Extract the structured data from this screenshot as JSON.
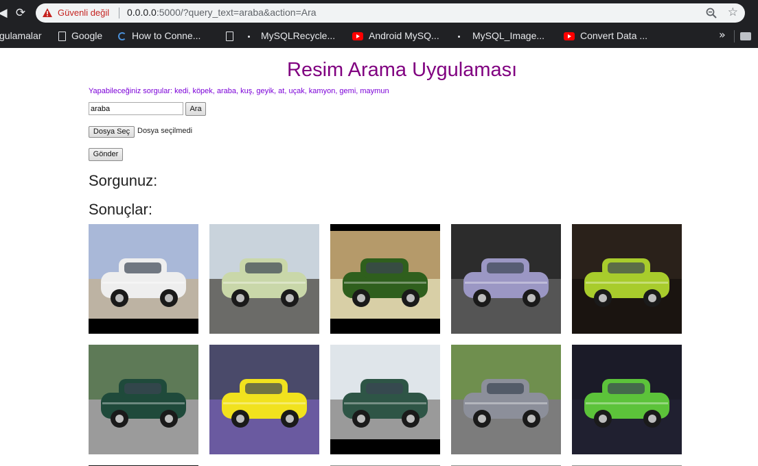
{
  "browser": {
    "security_label": "Güvenli değil",
    "url_host": "0.0.0.0",
    "url_rest": ":5000/?query_text=araba&action=Ara",
    "bookmarks": [
      {
        "label": "gulamalar",
        "icon": "none"
      },
      {
        "label": "Google",
        "icon": "doc-icon"
      },
      {
        "label": "How to Conne...",
        "icon": "loading-icon"
      },
      {
        "label": "",
        "icon": "doc-icon"
      },
      {
        "label": "MySQLRecycle...",
        "icon": "dot-icon"
      },
      {
        "label": "Android MySQ...",
        "icon": "youtube-icon"
      },
      {
        "label": "MySQL_Image...",
        "icon": "dot-icon"
      },
      {
        "label": "Convert Data ...",
        "icon": "youtube-icon"
      }
    ],
    "more_label": "»"
  },
  "page": {
    "title": "Resim Arama Uygulaması",
    "hint": "Yapabileceğiniz sorgular: kedi, köpek, araba, kuş, geyik, at, uçak, kamyon, gemi, maymun",
    "search_value": "araba",
    "search_button": "Ara",
    "file_button": "Dosya Seç",
    "file_status": "Dosya seçilmedi",
    "submit_button": "Gönder",
    "query_heading": "Sorgunuz:",
    "results_heading": "Sonuçlar:"
  },
  "results": [
    {
      "name": "white convertible by the sea",
      "colors": {
        "sky": "#a9b8d8",
        "ground": "#bdb3a3",
        "body": "#eeeeee",
        "frame": "#000000"
      }
    },
    {
      "name": "pale green vintage car",
      "colors": {
        "sky": "#c9d3dc",
        "ground": "#6b6b68",
        "body": "#c9d7a9",
        "frame": "#000000"
      }
    },
    {
      "name": "dark green muscle car",
      "colors": {
        "sky": "#b59a6a",
        "ground": "#d8cfa6",
        "body": "#2f5f1d",
        "frame": "#000000"
      }
    },
    {
      "name": "small purple electric car",
      "colors": {
        "sky": "#2c2c2c",
        "ground": "#555555",
        "body": "#9b97c4",
        "frame": "#000000"
      }
    },
    {
      "name": "lime green flamed hot rod",
      "colors": {
        "sky": "#2a211a",
        "ground": "#1a1410",
        "body": "#a8cc2c",
        "frame": "#000000"
      }
    },
    {
      "name": "dark green classic car close-up",
      "colors": {
        "sky": "#5e7a57",
        "ground": "#9b9b9b",
        "body": "#1f4a3b",
        "frame": "#000000"
      }
    },
    {
      "name": "yellow bubble car",
      "colors": {
        "sky": "#4a4a6a",
        "ground": "#6a5aa0",
        "body": "#f1e21e",
        "frame": "#000000"
      }
    },
    {
      "name": "green 1940s sedan",
      "colors": {
        "sky": "#dfe5ea",
        "ground": "#9a9a9a",
        "body": "#2e5546",
        "frame": "#000000"
      }
    },
    {
      "name": "silver sports car with plate",
      "colors": {
        "sky": "#6f8f4e",
        "ground": "#7c7c7c",
        "body": "#8c8f9a",
        "frame": "#000000"
      }
    },
    {
      "name": "green hatchback rear",
      "colors": {
        "sky": "#1b1b28",
        "ground": "#202030",
        "body": "#5cc33a",
        "frame": "#000000"
      }
    }
  ]
}
